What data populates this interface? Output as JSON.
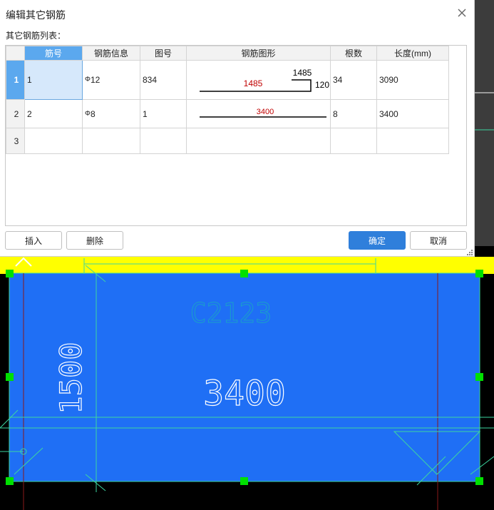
{
  "dialog": {
    "title": "编辑其它钢筋",
    "list_label": "其它钢筋列表：",
    "columns": [
      "筋号",
      "钢筋信息",
      "图号",
      "钢筋图形",
      "根数",
      "长度(mm)"
    ],
    "rows": [
      {
        "row": "1",
        "bar_no": "1",
        "sym": "Φ",
        "bar_info": "12",
        "shape_no": "834",
        "shape": {
          "top": "1485",
          "middle": "1485",
          "right": "120"
        },
        "count": "34",
        "length": "3090"
      },
      {
        "row": "2",
        "bar_no": "2",
        "sym": "Φ",
        "bar_info": "8",
        "shape_no": "1",
        "shape": {
          "middle": "3400"
        },
        "count": "8",
        "length": "3400"
      },
      {
        "row": "3",
        "bar_no": "",
        "sym": "",
        "bar_info": "",
        "shape_no": "",
        "count": "",
        "length": ""
      }
    ],
    "buttons": {
      "insert": "插入",
      "delete": "删除",
      "ok": "确定",
      "cancel": "取消"
    }
  },
  "cad": {
    "label_component": "C2123",
    "dim_width": "3400",
    "dim_height": "1500",
    "colors": {
      "panel": "#1f6ff5",
      "highlight": "#ffff00",
      "grip": "#00e000",
      "line": "#3dd6a0"
    }
  }
}
